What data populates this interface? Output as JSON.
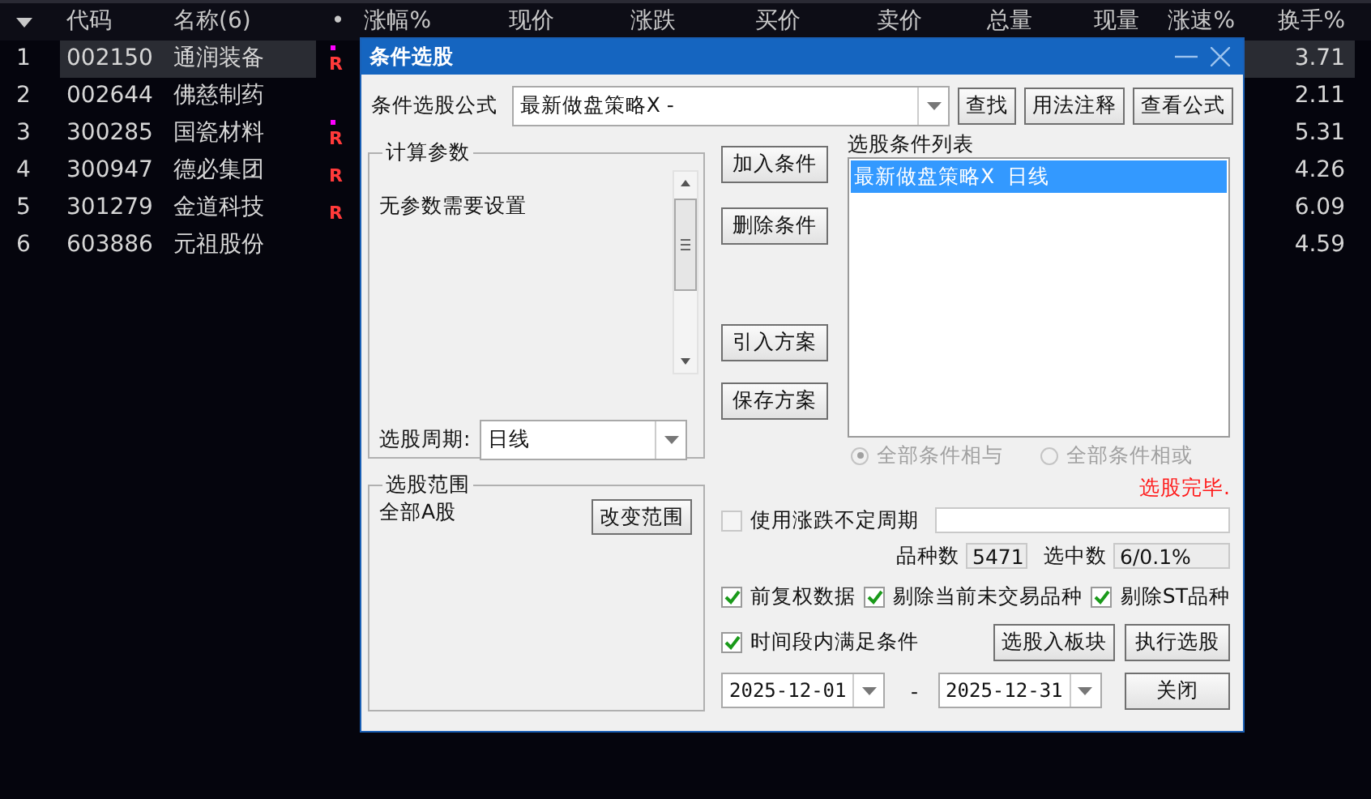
{
  "table": {
    "columns": [
      "代码",
      "名称(6)",
      "•",
      "涨幅%",
      "现价",
      "涨跌",
      "买价",
      "卖价",
      "总量",
      "现量",
      "涨速%",
      "换手%"
    ],
    "rows": [
      {
        "index": "1",
        "code": "002150",
        "name": "通润装备",
        "r_mark": "R",
        "dot": true,
        "turnover": "3.71",
        "selected": true
      },
      {
        "index": "2",
        "code": "002644",
        "name": "佛慈制药",
        "dot": false,
        "turnover": "2.11",
        "selected": false
      },
      {
        "index": "3",
        "code": "300285",
        "name": "国瓷材料",
        "r_mark": "R",
        "dot": true,
        "turnover": "5.31",
        "selected": false
      },
      {
        "index": "4",
        "code": "300947",
        "name": "德必集团",
        "r_mark": "R",
        "dot": false,
        "turnover": "4.26",
        "selected": false
      },
      {
        "index": "5",
        "code": "301279",
        "name": "金道科技",
        "r_mark": "R",
        "dot": false,
        "turnover": "6.09",
        "selected": false
      },
      {
        "index": "6",
        "code": "603886",
        "name": "元祖股份",
        "dot": false,
        "turnover": "4.59",
        "selected": false
      }
    ]
  },
  "dialog": {
    "title": "条件选股",
    "formula": {
      "label": "条件选股公式",
      "value": "最新做盘策略X  -"
    },
    "top_buttons": [
      "查找",
      "用法注释",
      "查看公式"
    ],
    "params": {
      "title": "计算参数",
      "text": "无参数需要设置",
      "period_label": "选股周期:",
      "period_value": "日线"
    },
    "scope": {
      "title": "选股范围",
      "text": "全部A股",
      "button": "改变范围"
    },
    "side_buttons": [
      "加入条件",
      "删除条件",
      "引入方案",
      "保存方案"
    ],
    "conditions": {
      "title": "选股条件列表",
      "items": [
        {
          "label": "最新做盘策略X  日线",
          "selected": true
        }
      ]
    },
    "logic": [
      {
        "label": "全部条件相与",
        "selected": true,
        "disabled": true
      },
      {
        "label": "全部条件相或",
        "selected": false,
        "disabled": true
      }
    ],
    "status": "选股完毕.",
    "variable_period": {
      "label": "使用涨跌不定周期",
      "checked": false
    },
    "counts": [
      {
        "label": "品种数",
        "value": "5471"
      },
      {
        "label": "选中数",
        "value": "6/0.1%"
      }
    ],
    "options": [
      {
        "label": "前复权数据",
        "checked": true
      },
      {
        "label": "剔除当前未交易品种",
        "checked": true
      },
      {
        "label": "剔除ST品种",
        "checked": true
      }
    ],
    "period_filter": {
      "label": "时间段内满足条件",
      "checked": true
    },
    "action_buttons": [
      "选股入板块",
      "执行选股"
    ],
    "date_from": "2025-12-01",
    "date_sep": "-",
    "date_to": "2025-12-31",
    "close_button": "关闭"
  }
}
